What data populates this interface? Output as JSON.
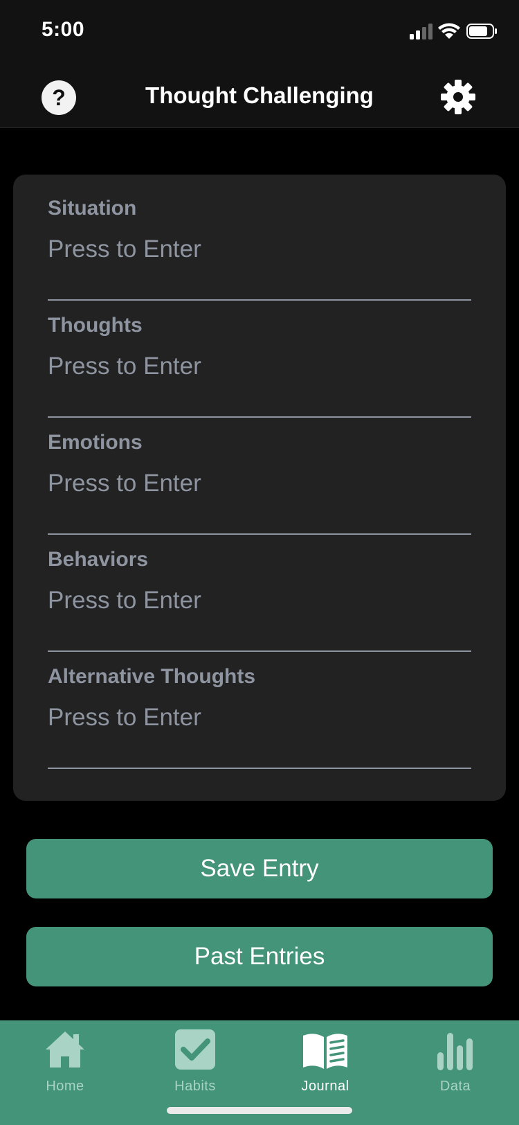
{
  "status_bar": {
    "time": "5:00"
  },
  "header": {
    "title": "Thought Challenging",
    "help_icon": "question-mark-icon",
    "settings_icon": "gear-icon"
  },
  "form": {
    "fields": [
      {
        "label": "Situation",
        "placeholder": "Press to Enter",
        "value": ""
      },
      {
        "label": "Thoughts",
        "placeholder": "Press to Enter",
        "value": ""
      },
      {
        "label": "Emotions",
        "placeholder": "Press to Enter",
        "value": ""
      },
      {
        "label": "Behaviors",
        "placeholder": "Press to Enter",
        "value": ""
      },
      {
        "label": "Alternative Thoughts",
        "placeholder": "Press to Enter",
        "value": ""
      }
    ]
  },
  "actions": {
    "save_label": "Save Entry",
    "past_label": "Past Entries"
  },
  "tab_bar": {
    "tabs": [
      {
        "label": "Home",
        "icon": "home-icon",
        "active": false
      },
      {
        "label": "Habits",
        "icon": "checkbox-icon",
        "active": false
      },
      {
        "label": "Journal",
        "icon": "book-icon",
        "active": true
      },
      {
        "label": "Data",
        "icon": "bar-chart-icon",
        "active": false
      }
    ]
  },
  "colors": {
    "accent": "#439479",
    "card": "#222223",
    "label": "#8e95a0",
    "header": "#121212"
  }
}
